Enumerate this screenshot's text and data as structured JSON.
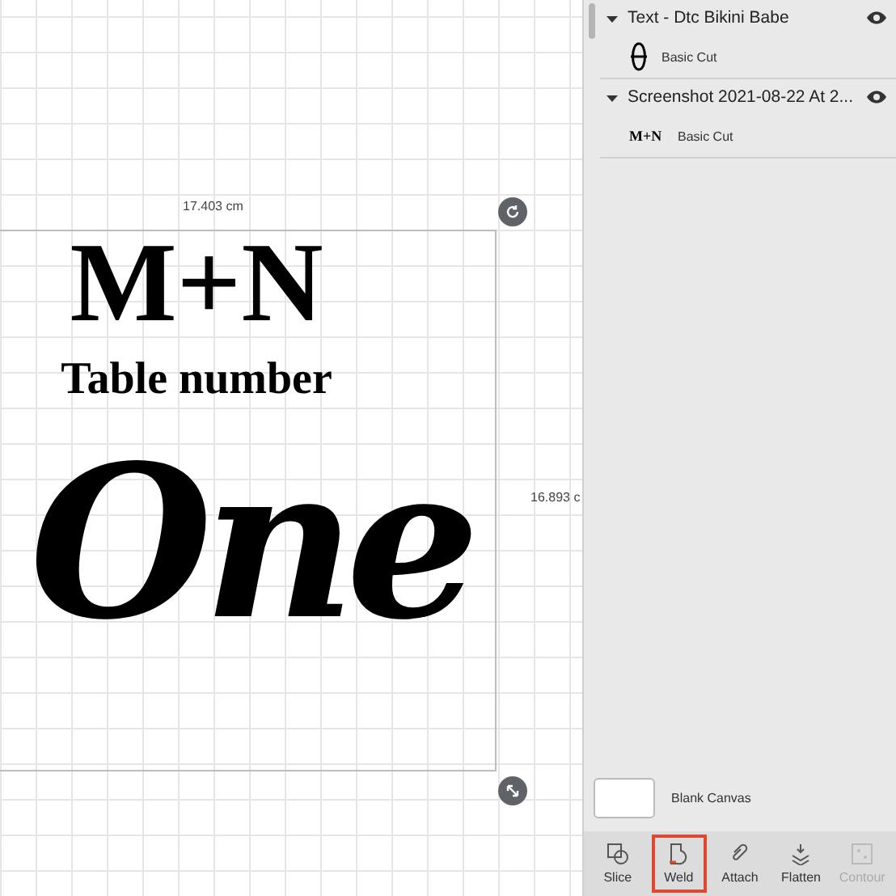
{
  "canvas": {
    "width_label": "17.403 cm",
    "height_label": "16.893 c",
    "design": [
      {
        "kind": "monogram",
        "text": "M+N"
      },
      {
        "kind": "heading",
        "text": "Table number"
      },
      {
        "kind": "script",
        "text": "One"
      }
    ]
  },
  "layers": [
    {
      "title": "Text - Dtc Bikini Babe",
      "expanded": true,
      "visible": true,
      "children": [
        {
          "label": "Basic Cut",
          "kind": "script"
        }
      ]
    },
    {
      "title": "Screenshot 2021-08-22 At 2...",
      "expanded": true,
      "visible": true,
      "children": [
        {
          "label": "Basic Cut",
          "kind": "monogram",
          "thumb_text": "M+N"
        }
      ]
    }
  ],
  "blank_canvas": {
    "label": "Blank Canvas"
  },
  "tools": [
    {
      "kind": "slice",
      "label": "Slice",
      "selected": false,
      "disabled": false
    },
    {
      "kind": "weld",
      "label": "Weld",
      "selected": true,
      "disabled": false
    },
    {
      "kind": "attach",
      "label": "Attach",
      "selected": false,
      "disabled": false
    },
    {
      "kind": "flatten",
      "label": "Flatten",
      "selected": false,
      "disabled": false
    },
    {
      "kind": "contour",
      "label": "Contour",
      "selected": false,
      "disabled": true
    }
  ]
}
